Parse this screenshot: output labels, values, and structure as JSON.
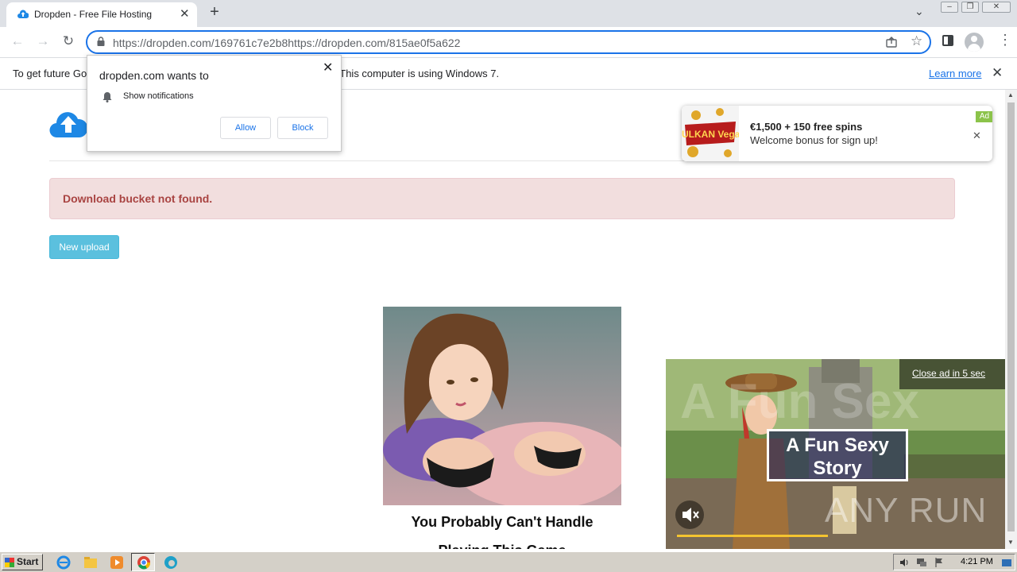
{
  "browser": {
    "tab_title": "Dropden - Free File Hosting",
    "url": "https://dropden.com/169761c7e2b8https://dropden.com/815ae0f5a622",
    "info_bar_message": "To get future Google Chrome updates, you'll need Windows 10 or later. This computer is using Windows 7.",
    "info_bar_link": "Learn more"
  },
  "permission_popup": {
    "heading": "dropden.com wants to",
    "permission": "Show notifications",
    "allow_label": "Allow",
    "block_label": "Block"
  },
  "page": {
    "alert_text": "Download bucket not found.",
    "upload_button": "New upload",
    "promo_caption_line1": "You Probably Can't Handle",
    "promo_caption_line2": "Playing This Game"
  },
  "notification_ad": {
    "title": "€1,500 + 150 free spins",
    "subtitle": "Welcome bonus for sign up!",
    "badge": "Ad",
    "brand": "VULKAN Vegas"
  },
  "video_ad": {
    "close_text": "Close ad in 5 sec",
    "title": "A Fun Sexy Story",
    "watermark": "A Fun Sex",
    "overlay_brand": "ANY RUN"
  },
  "taskbar": {
    "start_label": "Start",
    "clock": "4:21 PM"
  },
  "colors": {
    "accent": "#1a73e8",
    "alert_bg": "#f2dede",
    "alert_text": "#a94442",
    "upload_button": "#5bc0de",
    "ad_badge": "#8bc34a"
  }
}
